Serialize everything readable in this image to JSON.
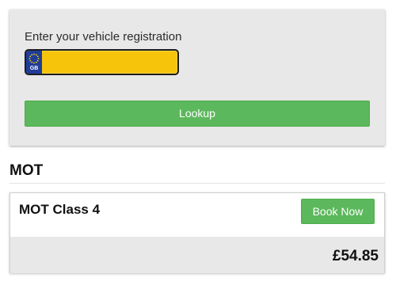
{
  "lookup": {
    "label": "Enter your vehicle registration",
    "plate_country": "GB",
    "plate_value": "",
    "plate_placeholder": "",
    "plate_color": "#f6c40a",
    "plate_band_color": "#1f3d99",
    "button_label": "Lookup",
    "button_color": "#5cb85c"
  },
  "section": {
    "title": "MOT"
  },
  "product": {
    "name": "MOT Class 4",
    "book_label": "Book Now",
    "price": "£54.85"
  }
}
